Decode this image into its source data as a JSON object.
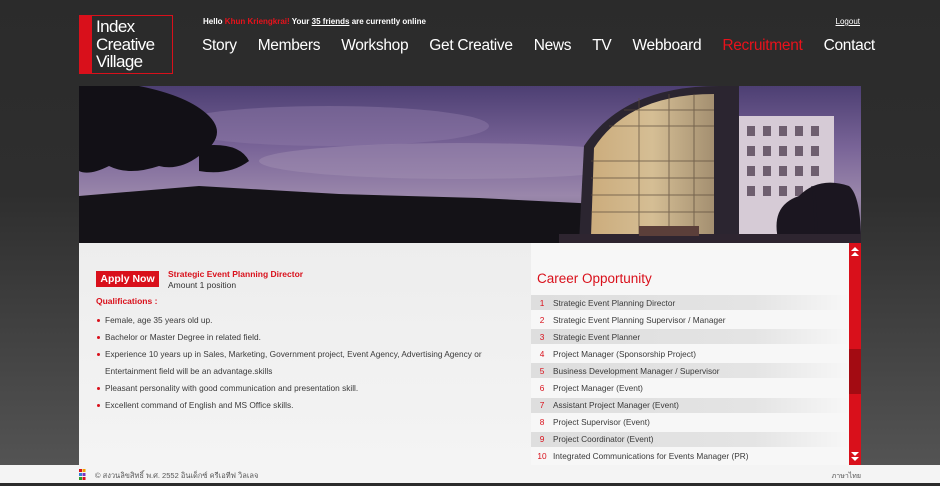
{
  "logo": {
    "line1": "Index",
    "line2": "Creative",
    "line3": "Village"
  },
  "greeting": {
    "hello": "Hello",
    "user": "Khun Kriengkrai!",
    "your": "Your",
    "friends": "35 friends",
    "tail": "are currently online"
  },
  "logout": "Logout",
  "nav": {
    "items": [
      "Story",
      "Members",
      "Workshop",
      "Get Creative",
      "News",
      "TV",
      "Webboard",
      "Recruitment",
      "Contact"
    ],
    "active": "Recruitment"
  },
  "job": {
    "apply_label": "Apply Now",
    "title": "Strategic Event Planning Director",
    "amount": "Amount 1 position",
    "qualifications_heading": "Qualifications :",
    "qualifications": [
      "Female, age 35 years old up.",
      "Bachelor or Master Degree in related field.",
      "Experience 10 years up in Sales, Marketing, Government project, Event Agency, Advertising Agency or",
      "Entertainment field will be an advantage.skills",
      "Pleasant personality with good communication and presentation skill.",
      "Excellent command of English and MS Office skills."
    ]
  },
  "career": {
    "heading": "Career Opportunity",
    "items": [
      {
        "num": "1",
        "label": "Strategic Event Planning Director"
      },
      {
        "num": "2",
        "label": "Strategic Event Planning Supervisor / Manager"
      },
      {
        "num": "3",
        "label": "Strategic Event Planner"
      },
      {
        "num": "4",
        "label": "Project Manager (Sponsorship Project)"
      },
      {
        "num": "5",
        "label": "Business Development Manager / Supervisor"
      },
      {
        "num": "6",
        "label": "Project Manager (Event)"
      },
      {
        "num": "7",
        "label": "Assistant Project Manager (Event)"
      },
      {
        "num": "8",
        "label": "Project Supervisor (Event)"
      },
      {
        "num": "9",
        "label": "Project Coordinator (Event)"
      },
      {
        "num": "10",
        "label": "Integrated Communications for Events Manager (PR)"
      }
    ]
  },
  "footer": {
    "copyright": "© สงวนลิขสิทธิ์ พ.ศ. 2552 อินเด็กซ์ ครีเอทีฟ วิลเลจ",
    "language": "ภาษาไทย"
  },
  "colors": {
    "accent": "#d9101b",
    "background": "#2b2b2b"
  }
}
